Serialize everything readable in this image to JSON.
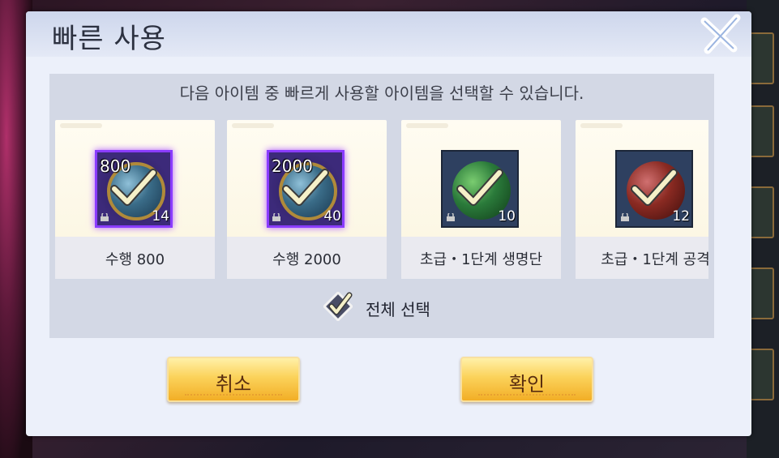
{
  "dialog": {
    "title": "빠른 사용",
    "instruction": "다음 아이템 중 빠르게 사용할 아이템을 선택할 수 있습니다.",
    "items": [
      {
        "name": "수행 800",
        "level_label": "800",
        "count": "14",
        "style": "purple-scroll",
        "checked": true
      },
      {
        "name": "수행 2000",
        "level_label": "2000",
        "count": "40",
        "style": "purple-scroll",
        "checked": true
      },
      {
        "name": "초급・1단계 생명단",
        "level_label": "",
        "count": "10",
        "style": "green-pill",
        "checked": true
      },
      {
        "name": "초급・1단계 공격",
        "level_label": "",
        "count": "12",
        "style": "red-pill",
        "checked": true
      }
    ],
    "select_all_label": "전체 선택",
    "select_all_checked": true,
    "cancel_label": "취소",
    "confirm_label": "확인"
  },
  "colors": {
    "panel": "#d3d8e5",
    "button_gold": "#fbd25a",
    "check": "#f5f0c8",
    "purple_glow": "#8a3cff"
  },
  "icons": [
    "close-icon",
    "check-icon",
    "lock-icon"
  ]
}
